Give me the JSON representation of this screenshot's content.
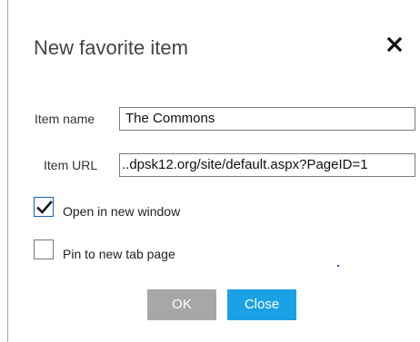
{
  "dialog": {
    "title": "New favorite item",
    "close_icon_glyph": "✕"
  },
  "form": {
    "item_name": {
      "label": "Item name",
      "value": "The Commons"
    },
    "item_url": {
      "label": "Item URL",
      "value": "..dpsk12.org/site/default.aspx?PageID=1"
    },
    "open_in_new_window": {
      "label": "Open in new window",
      "checked": true
    },
    "pin_to_new_tab_page": {
      "label": "Pin to new tab page",
      "checked": false
    }
  },
  "buttons": {
    "ok_label": "OK",
    "close_label": "Close"
  },
  "colors": {
    "ok_button_bg": "#a7a7a7",
    "close_button_bg": "#1aa1e5",
    "checkmark": "#1a1a1a"
  },
  "icons": {
    "close": "close-icon",
    "checkmark": "checkmark-icon"
  }
}
